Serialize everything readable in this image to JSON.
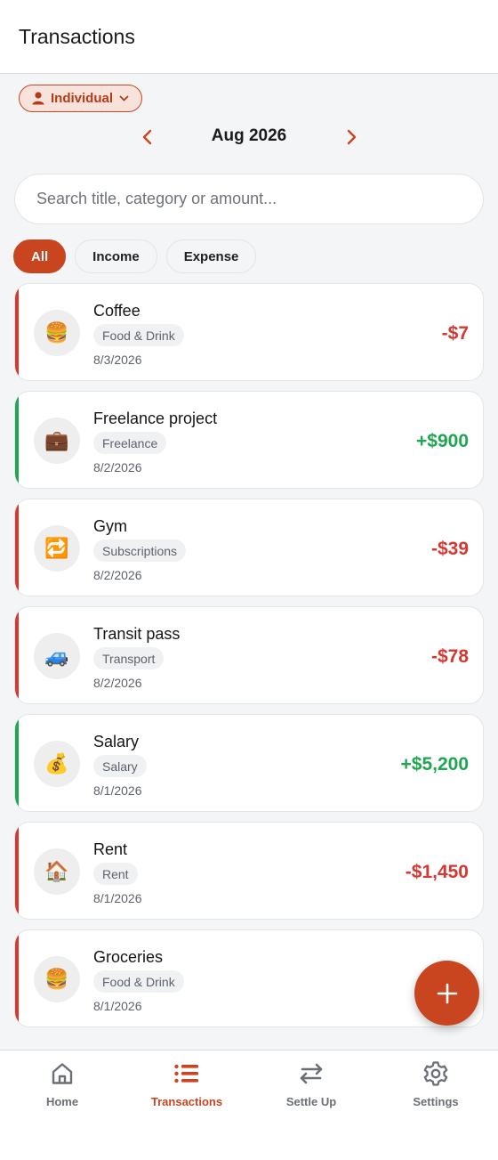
{
  "header": {
    "title": "Transactions"
  },
  "scope": {
    "label": "Individual"
  },
  "month": {
    "label": "Aug 2026"
  },
  "search": {
    "placeholder": "Search title, category or amount..."
  },
  "filters": [
    {
      "label": "All",
      "active": true
    },
    {
      "label": "Income",
      "active": false
    },
    {
      "label": "Expense",
      "active": false
    }
  ],
  "transactions": [
    {
      "title": "Coffee",
      "category": "Food & Drink",
      "date": "8/3/2026",
      "amount": "-$7",
      "kind": "expense",
      "icon": "burger-icon"
    },
    {
      "title": "Freelance project",
      "category": "Freelance",
      "date": "8/2/2026",
      "amount": "+$900",
      "kind": "income",
      "icon": "briefcase-icon"
    },
    {
      "title": "Gym",
      "category": "Subscriptions",
      "date": "8/2/2026",
      "amount": "-$39",
      "kind": "expense",
      "icon": "repeat-icon"
    },
    {
      "title": "Transit pass",
      "category": "Transport",
      "date": "8/2/2026",
      "amount": "-$78",
      "kind": "expense",
      "icon": "car-icon"
    },
    {
      "title": "Salary",
      "category": "Salary",
      "date": "8/1/2026",
      "amount": "+$5,200",
      "kind": "income",
      "icon": "money-bag-icon"
    },
    {
      "title": "Rent",
      "category": "Rent",
      "date": "8/1/2026",
      "amount": "-$1,450",
      "kind": "expense",
      "icon": "house-icon"
    },
    {
      "title": "Groceries",
      "category": "Food & Drink",
      "date": "8/1/2026",
      "amount": "",
      "kind": "expense",
      "icon": "burger-icon"
    }
  ],
  "nav": [
    {
      "label": "Home",
      "icon": "home-icon",
      "active": false
    },
    {
      "label": "Transactions",
      "icon": "list-icon",
      "active": true
    },
    {
      "label": "Settle Up",
      "icon": "swap-arrows-icon",
      "active": false
    },
    {
      "label": "Settings",
      "icon": "gear-icon",
      "active": false
    }
  ],
  "colors": {
    "accent": "#c9451f",
    "expense": "#d6372f",
    "income": "#1fa650"
  }
}
